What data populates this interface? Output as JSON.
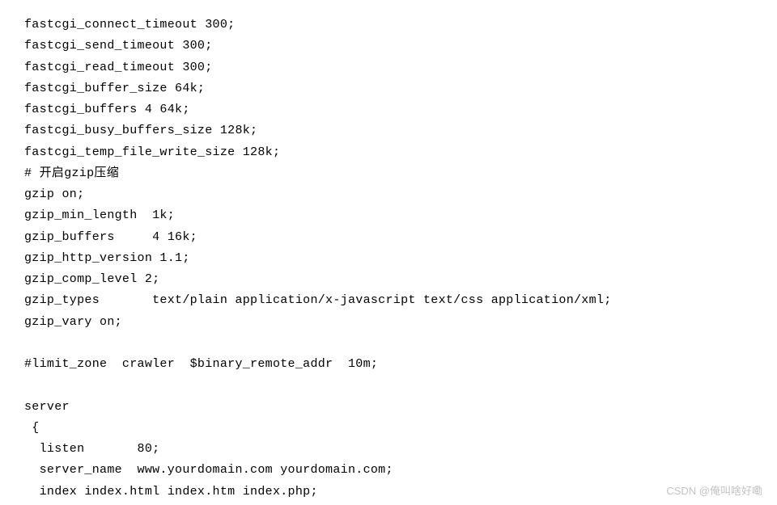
{
  "config_lines": [
    "fastcgi_connect_timeout 300;",
    "fastcgi_send_timeout 300;",
    "fastcgi_read_timeout 300;",
    "fastcgi_buffer_size 64k;",
    "fastcgi_buffers 4 64k;",
    "fastcgi_busy_buffers_size 128k;",
    "fastcgi_temp_file_write_size 128k;",
    "# 开启gzip压缩",
    "gzip on;",
    "gzip_min_length  1k;",
    "gzip_buffers     4 16k;",
    "gzip_http_version 1.1;",
    "gzip_comp_level 2;",
    "gzip_types       text/plain application/x-javascript text/css application/xml;",
    "gzip_vary on;",
    "",
    "#limit_zone  crawler  $binary_remote_addr  10m;",
    "",
    "server",
    " {",
    "  listen       80;",
    "  server_name  www.yourdomain.com yourdomain.com;",
    "  index index.html index.htm index.php;"
  ],
  "watermark": "CSDN @俺叫啥好嘞"
}
